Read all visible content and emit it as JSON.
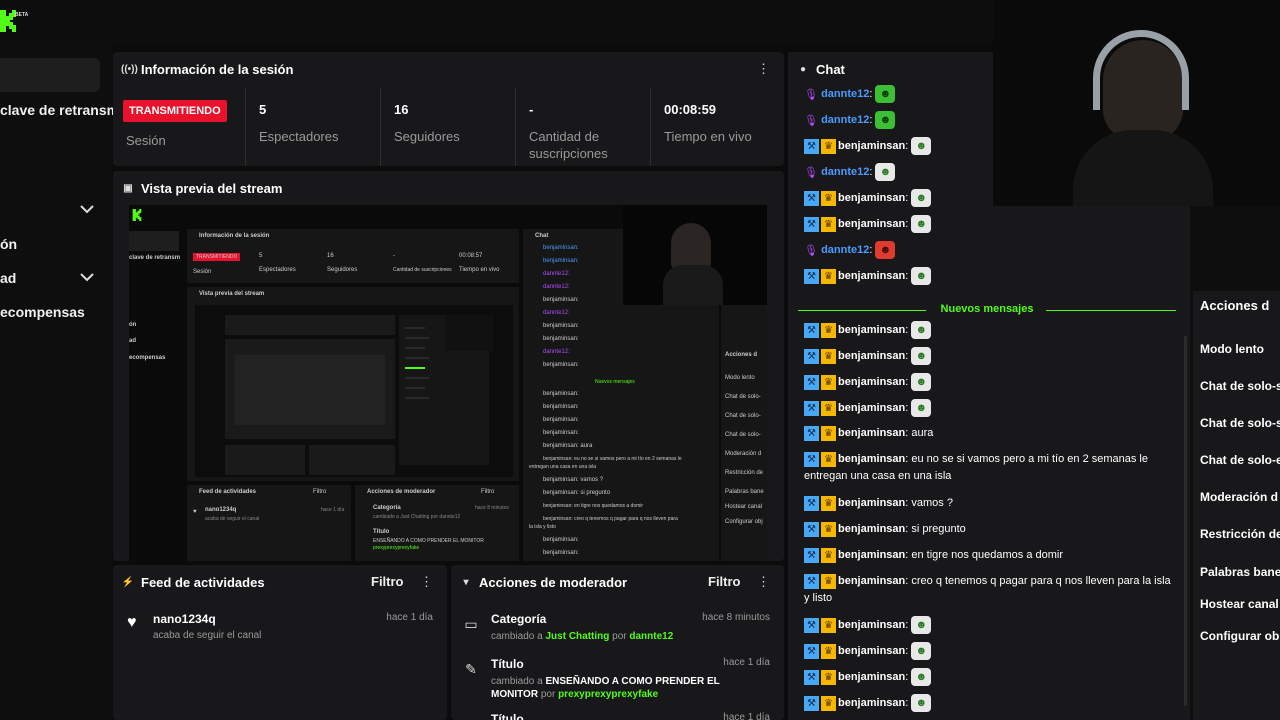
{
  "app": {
    "beta": "BETA"
  },
  "sidebar": {
    "items": [
      {
        "label": "clave de retransm"
      },
      {
        "label": "ón"
      },
      {
        "label": "ad"
      },
      {
        "label": "ecompensas"
      }
    ]
  },
  "session": {
    "title": "Información de la sesión",
    "status": "TRANSMITIENDO",
    "status_label": "Sesión",
    "viewers": "5",
    "viewers_label": "Espectadores",
    "followers": "16",
    "followers_label": "Seguidores",
    "subs": "-",
    "subs_label_1": "Cantidad de",
    "subs_label_2": "suscripciones",
    "uptime": "00:08:59",
    "uptime_label": "Tiempo en vivo"
  },
  "preview": {
    "title": "Vista previa del stream",
    "mini": {
      "session_title": "Información de la sesión",
      "stream_key": "clave de retransm",
      "live": "TRANSMITIENDO",
      "session": "Sesión",
      "viewers": "5",
      "viewers_label": "Espectadores",
      "followers": "16",
      "followers_label": "Seguidores",
      "subs": "-",
      "subs_label": "Cantidad de suscripciones",
      "uptime": "00:08:57",
      "uptime_label": "Tiempo en vivo",
      "preview_title": "Vista previa del stream",
      "chat": "Chat",
      "new_msgs": "Nuevos mensajes",
      "feed": "Feed de actividades",
      "mod": "Acciones de moderador",
      "filter": "Filtro",
      "feed_user": "nano1234q",
      "feed_sub": "acaba de seguir el canal",
      "time": "hace 1 día",
      "cat": "Categoría",
      "cat_desc": "cambiado a Just Chatting por dannte12",
      "title": "Título",
      "title_desc": "ENSEÑANDO A COMO PRENDER EL MONITOR",
      "title_by": "prexyprexyprexyfake",
      "mod_time": "hace 8 minutos",
      "actions": "Acciones d",
      "slow": "Modo lento",
      "act2": "Chat de solo-",
      "act3": "Chat de solo-",
      "act4": "Chat de solo-",
      "act5": "Moderación d",
      "act6": "Restricción de",
      "act7": "Palabras bane",
      "act8": "Hostear canal",
      "act9": "Configurar obj",
      "m1": "benjaminsan:",
      "m2": "dannte12:",
      "m3": "benjaminsan: aura",
      "m4": "benjaminsan: eu no se si vamos pero a mi tío en 2 semanas le",
      "m4b": "entregan una casa en una isla",
      "m5": "benjaminsan: vamos ?",
      "m6": "benjaminsan: si pregunto",
      "m7": "benjaminsan: en tigre nos quedamos a domir",
      "m8": "benjaminsan: creo q tenemos q pagar para q nos lleven para",
      "m8b": "la isla y listo",
      "s1": "ón",
      "s2": "ad",
      "s3": "ecompensas"
    }
  },
  "feed": {
    "title": "Feed de actividades",
    "filter": "Filtro",
    "items": [
      {
        "user": "nano1234q",
        "text": "acaba de seguir el canal",
        "time": "hace 1 día"
      }
    ]
  },
  "moderator": {
    "title": "Acciones de moderador",
    "filter": "Filtro",
    "items": [
      {
        "title": "Categoría",
        "pre": "cambiado a",
        "value": "Just Chatting",
        "mid": "por",
        "user": "dannte12",
        "time": "hace 8 minutos"
      },
      {
        "title": "Título",
        "pre": "cambiado a",
        "value": "ENSEÑANDO A COMO PRENDER EL MONITOR",
        "mid": "por",
        "user": "prexyprexyprexyfake",
        "time": "hace 1 día"
      },
      {
        "title": "Título",
        "time": "hace 1 día"
      }
    ]
  },
  "chat": {
    "title": "Chat",
    "new_messages": "Nuevos mensajes",
    "messages": [
      {
        "user": "dannte12",
        "text": ""
      },
      {
        "user": "dannte12",
        "text": ""
      },
      {
        "user": "benjaminsan",
        "text": ""
      },
      {
        "user": "dannte12",
        "text": ""
      },
      {
        "user": "benjaminsan",
        "text": ""
      },
      {
        "user": "benjaminsan",
        "text": ""
      },
      {
        "user": "dannte12",
        "text": ""
      },
      {
        "user": "benjaminsan",
        "text": ""
      },
      {
        "user": "benjaminsan",
        "text": ""
      },
      {
        "user": "benjaminsan",
        "text": ""
      },
      {
        "user": "benjaminsan",
        "text": ""
      },
      {
        "user": "benjaminsan",
        "text": ""
      },
      {
        "user": "benjaminsan",
        "text": "aura"
      },
      {
        "user": "benjaminsan",
        "text": "eu no se si vamos pero a mi tío en 2 semanas le entregan una casa en una isla"
      },
      {
        "user": "benjaminsan",
        "text": "vamos ?"
      },
      {
        "user": "benjaminsan",
        "text": "si pregunto"
      },
      {
        "user": "benjaminsan",
        "text": "en tigre nos quedamos a domir"
      },
      {
        "user": "benjaminsan",
        "text": "creo q tenemos q pagar para q nos lleven para la isla y listo"
      },
      {
        "user": "benjaminsan",
        "text": ""
      },
      {
        "user": "benjaminsan",
        "text": ""
      },
      {
        "user": "benjaminsan",
        "text": ""
      },
      {
        "user": "benjaminsan",
        "text": ""
      }
    ],
    "colon": ":"
  },
  "actions": {
    "title": "Acciones d",
    "items": [
      "Modo lento",
      "Chat de solo-s",
      "Chat de solo-s",
      "Chat de solo-e",
      "Moderación d",
      "Restricción de",
      "Palabras bane",
      "Hostear canal",
      "Configurar ob"
    ]
  },
  "colors": {
    "accent": "#53fc18",
    "live": "#e8122c",
    "mod_badge": "#4aa7f5",
    "crown": "#f5b700",
    "dannte": "#4b9bff",
    "benja": "#ffffff"
  }
}
